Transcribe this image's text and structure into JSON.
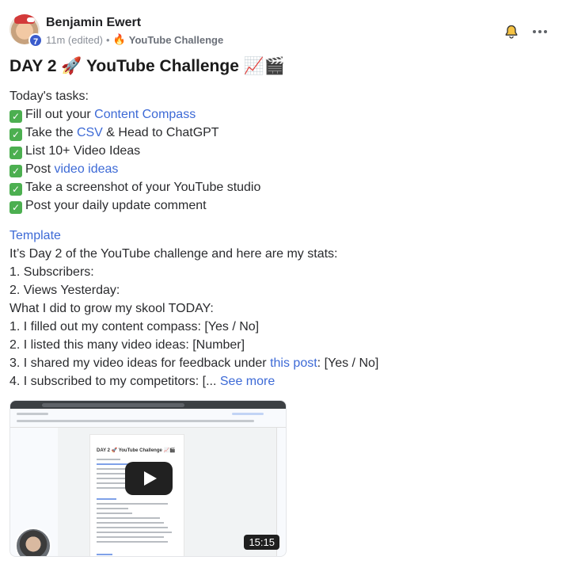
{
  "post": {
    "author": "Benjamin Ewert",
    "level": "7",
    "time": "11m (edited)",
    "separator": "•",
    "category_emoji": "🔥",
    "category": "YouTube Challenge",
    "title": "DAY 2 🚀 YouTube Challenge 📈🎬"
  },
  "tasks": {
    "heading": "Today's tasks:",
    "check": "✓",
    "items": [
      {
        "pre": "Fill out your ",
        "link": "Content Compass",
        "post": ""
      },
      {
        "pre": "Take the ",
        "link": "CSV",
        "post": " & Head to ChatGPT"
      },
      {
        "pre": "List 10+ Video Ideas",
        "link": "",
        "post": ""
      },
      {
        "pre": "Post ",
        "link": "video ideas",
        "post": ""
      },
      {
        "pre": "Take a screenshot of your YouTube studio",
        "link": "",
        "post": ""
      },
      {
        "pre": "Post your daily update comment",
        "link": "",
        "post": ""
      }
    ]
  },
  "template": {
    "link": "Template",
    "lines": [
      "It’s Day 2 of the YouTube challenge and here are my stats:",
      "1. Subscribers:",
      "2. Views Yesterday:",
      "What I did to grow my skool TODAY:",
      "1. I filled out my content compass: [Yes / No]",
      "2. I listed this many video ideas: [Number]"
    ],
    "line7_pre": "3. I shared my video ideas for feedback under ",
    "line7_link": "this post",
    "line7_post": ": [Yes / No]",
    "line8_pre": "4. I subscribed to my competitors: [... ",
    "see_more": "See more"
  },
  "video": {
    "doc_title": "DAY 2 🚀 YouTube Challenge 📈🎬",
    "duration": "15:15"
  },
  "colors": {
    "link": "#3d6ad6",
    "badge": "#3a5bcc",
    "check": "#4caf50"
  }
}
